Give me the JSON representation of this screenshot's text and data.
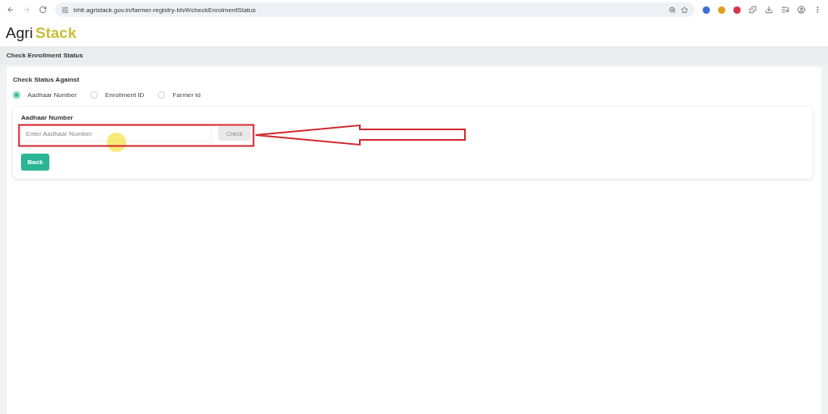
{
  "browser": {
    "url": "bhfr.agristack.gov.in/farmer-registry-bh/#/checkEnrolmentStatus"
  },
  "logo": {
    "first": "Agri",
    "second": "Stack"
  },
  "page_title": "Check Enrollment Status",
  "section_label": "Check Status Against",
  "options": [
    {
      "label": "Aadhaar Number",
      "selected": true
    },
    {
      "label": "Enrollment ID",
      "selected": false
    },
    {
      "label": "Farmer Id",
      "selected": false
    }
  ],
  "field": {
    "label": "Aadhaar Number",
    "placeholder": "Enter Aadhaar Number"
  },
  "check_button": {
    "label": "Check",
    "disabled": true
  },
  "back_button": "Back",
  "annotation": {
    "highlight": true,
    "arrow": true
  }
}
